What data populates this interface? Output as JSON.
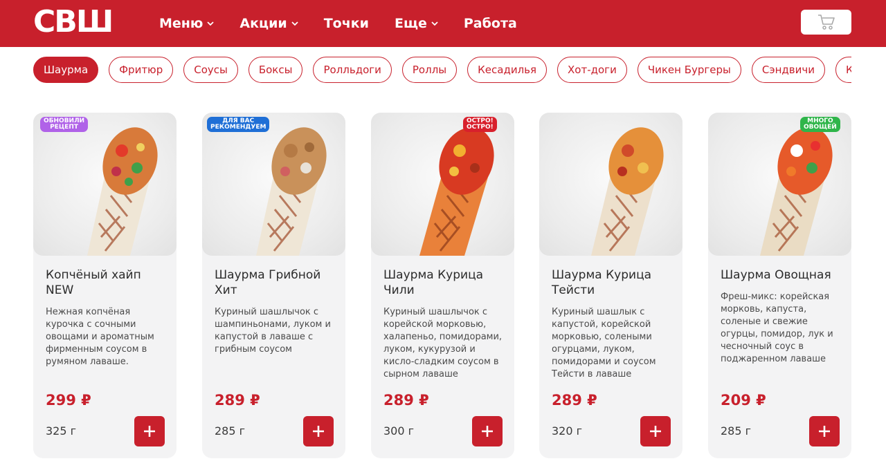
{
  "header": {
    "logo": "СВШ",
    "nav": [
      {
        "label": "Меню",
        "has_dropdown": true
      },
      {
        "label": "Акции",
        "has_dropdown": true
      },
      {
        "label": "Точки",
        "has_dropdown": false
      },
      {
        "label": "Еще",
        "has_dropdown": true
      },
      {
        "label": "Работа",
        "has_dropdown": false
      }
    ],
    "cart_icon": "cart-icon"
  },
  "categories": {
    "active_index": 0,
    "items": [
      "Шаурма",
      "Фритюр",
      "Соусы",
      "Боксы",
      "Ролльдоги",
      "Роллы",
      "Кесадилья",
      "Хот-доги",
      "Чикен Бургеры",
      "Сэндвичи",
      "Комбо"
    ]
  },
  "products": [
    {
      "badge": {
        "lines": [
          "обновили",
          "рецепт"
        ],
        "color": "#b062e8"
      },
      "title": "Копчёный хайп NEW",
      "description": "Нежная копчёная курочка с сочными овощами и ароматным фирменным соусом в румяном лаваше.",
      "price": "299 ₽",
      "weight": "325 г"
    },
    {
      "badge": {
        "lines": [
          "для вас",
          "рекомендуем"
        ],
        "color": "#1f6fd6"
      },
      "title": "Шаурма Грибной Хит",
      "description": "Куриный шашлычок с шампиньонами, луком и капустой в лаваше с грибным соусом",
      "price": "289 ₽",
      "weight": "285 г"
    },
    {
      "badge": {
        "lines": [
          "остро!",
          "остро!"
        ],
        "color": "#d8202c"
      },
      "title": "Шаурма Курица Чили",
      "description": "Куриный шашлычок с корейской морковью, халапеньо, помидорами, луком, кукурузой и кисло-сладким соусом в сырном лаваше",
      "price": "289 ₽",
      "weight": "300 г"
    },
    {
      "badge": null,
      "title": "Шаурма Курица Тейсти",
      "description": "Куриный шашлык с капустой, корейской морковью, солеными огурцами, луком, помидорами и соусом Тейсти в лаваше",
      "price": "289 ₽",
      "weight": "320 г"
    },
    {
      "badge": {
        "lines": [
          "много",
          "овощей"
        ],
        "color": "#2fb54a"
      },
      "title": "Шаурма Овощная",
      "description": "Фреш-микс: корейская морковь, капуста, соленые и свежие огурцы, помидор, лук и чесночный соус в поджаренном лаваше",
      "price": "209 ₽",
      "weight": "285 г"
    }
  ],
  "add_icon": "plus-icon",
  "colors": {
    "brand_red": "#c8202c",
    "card_bg": "#f3f3f4"
  }
}
